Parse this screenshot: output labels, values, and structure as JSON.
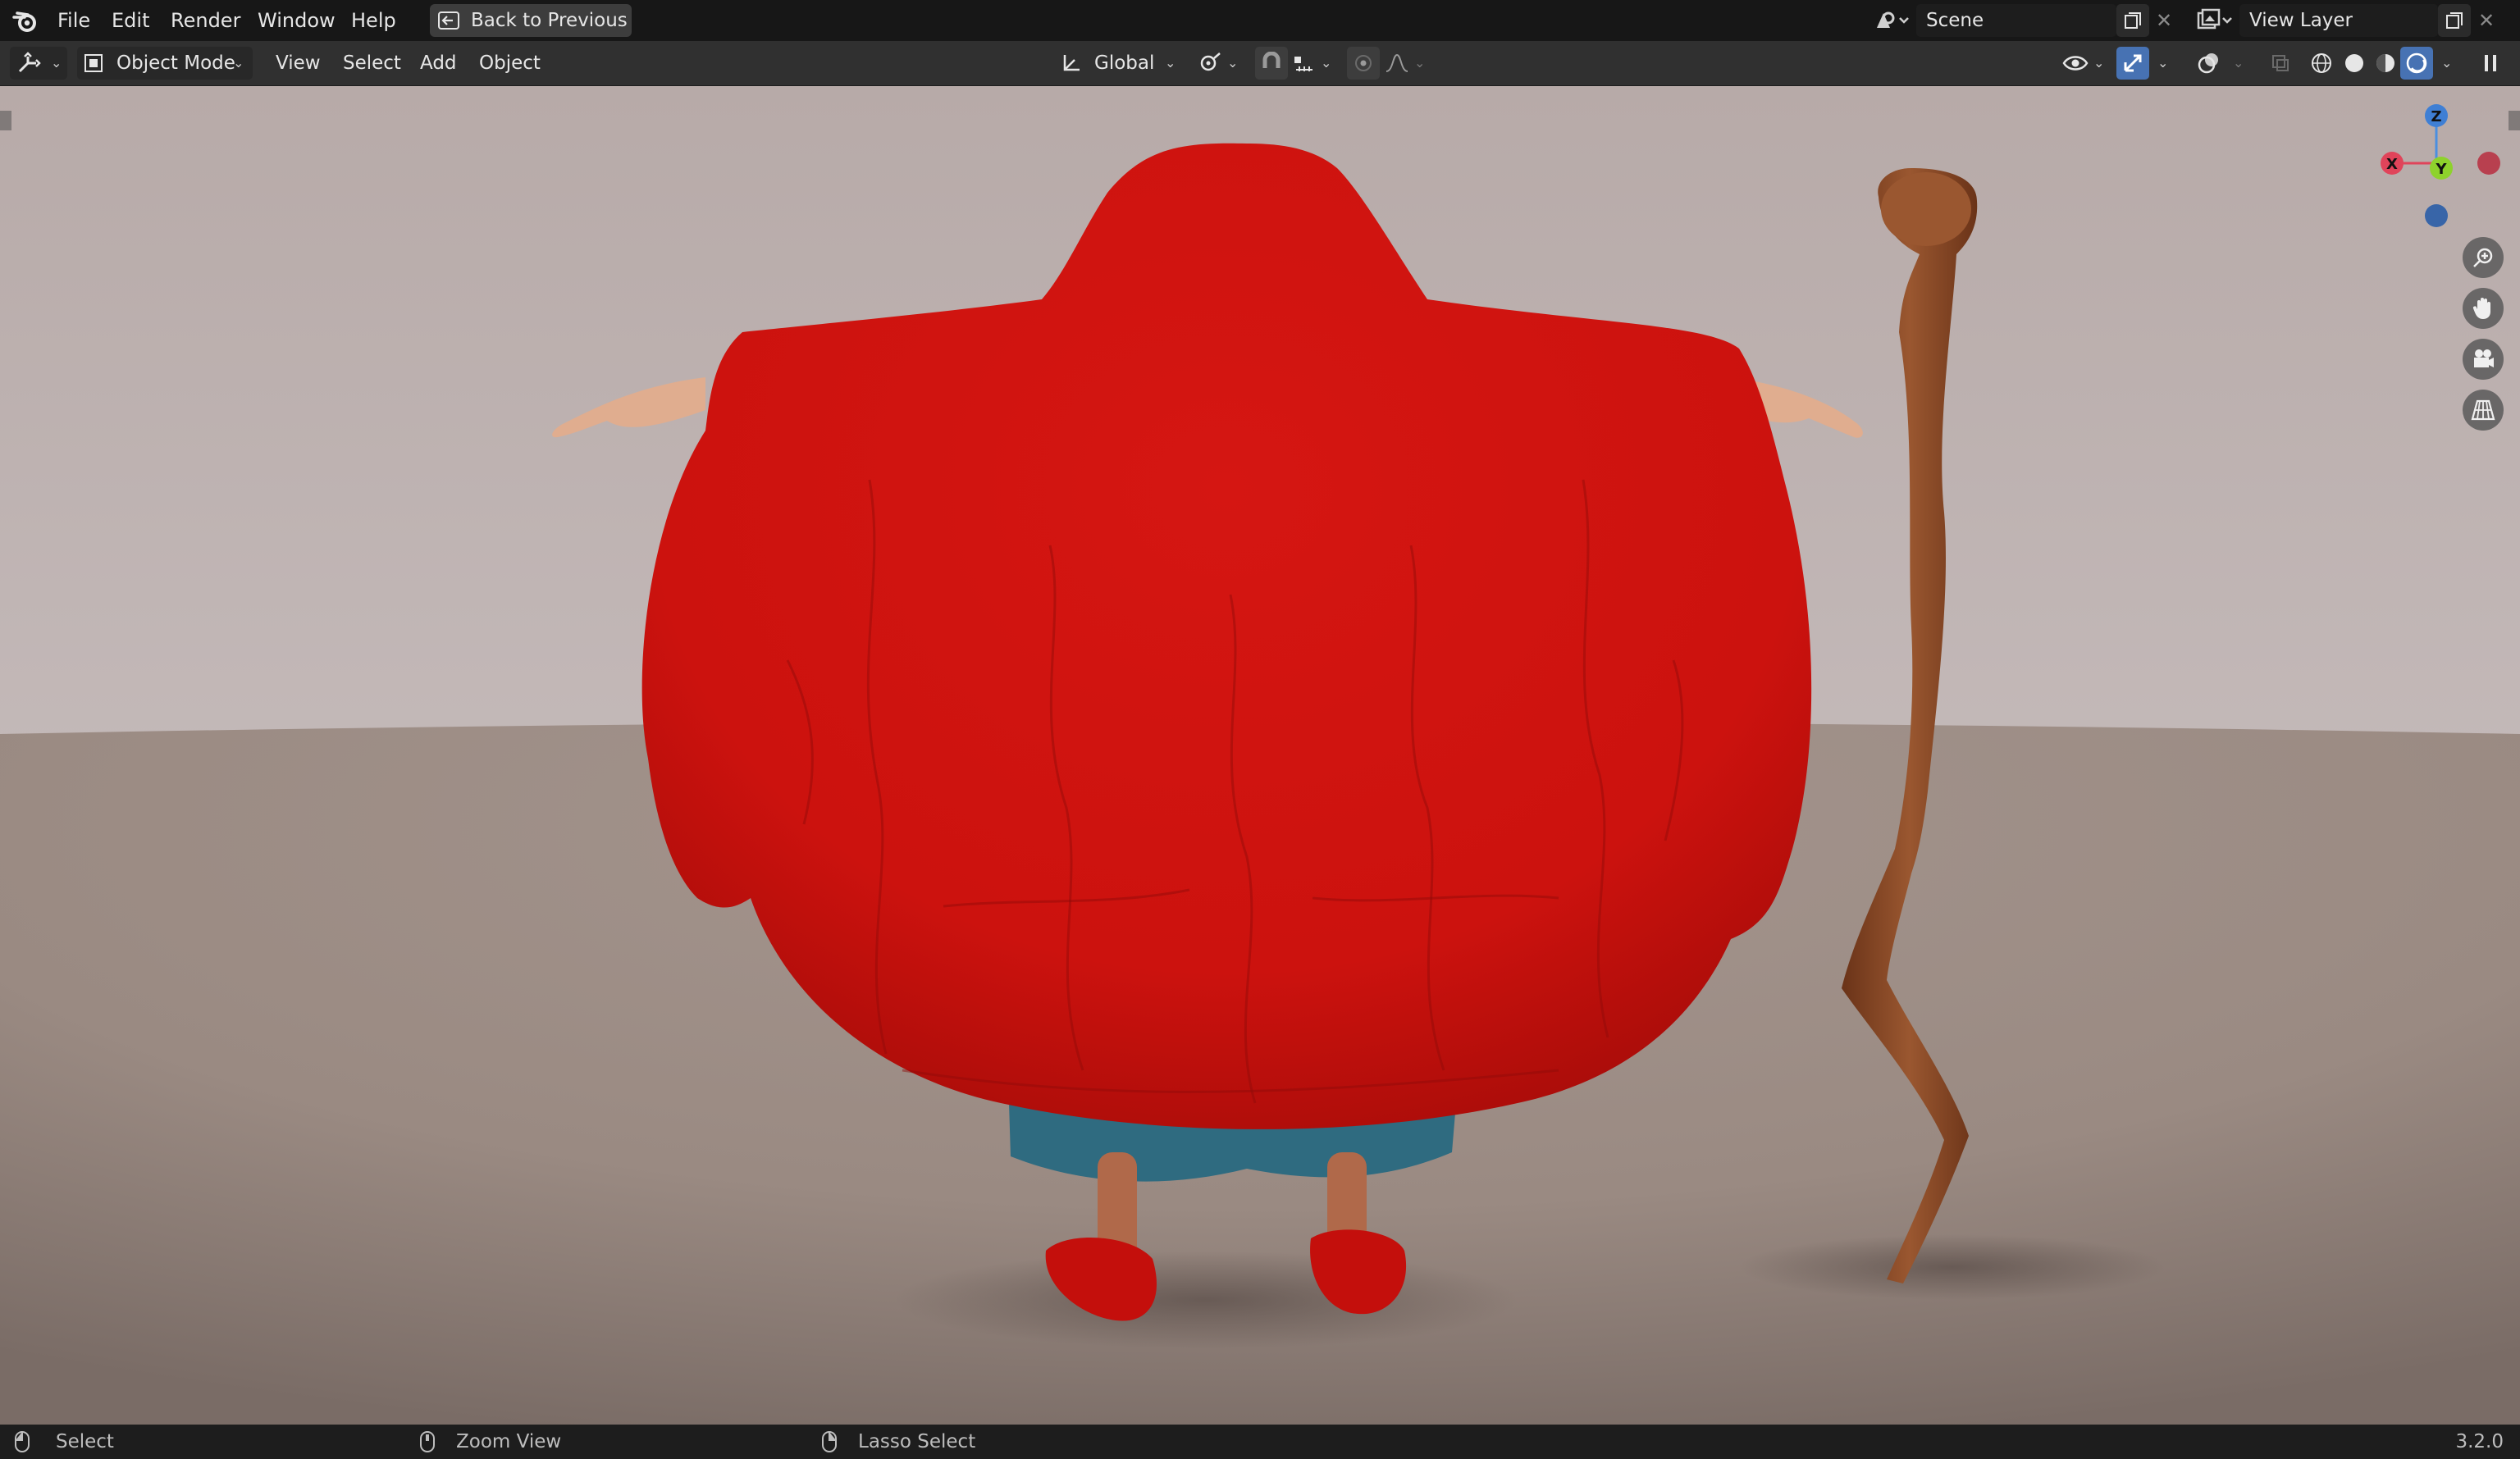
{
  "menu": {
    "items": [
      "File",
      "Edit",
      "Render",
      "Window",
      "Help"
    ],
    "back_button": "Back to Previous"
  },
  "scene": {
    "label": "Scene"
  },
  "view_layer": {
    "label": "View Layer"
  },
  "header": {
    "mode": "Object Mode",
    "menus": [
      "View",
      "Select",
      "Add",
      "Object"
    ],
    "transform_orientation": "Global"
  },
  "gizmo": {
    "z": "Z",
    "y": "Y",
    "x": "X"
  },
  "statusbar": {
    "select": "Select",
    "zoom": "Zoom View",
    "lasso": "Lasso Select",
    "version": "3.2.0"
  },
  "colors": {
    "cloak": "#d4110f",
    "staff": "#8a4a28",
    "skirt": "#2f6b80",
    "active_icon": "#4772b3"
  },
  "icons": [
    "blender-logo-icon",
    "back-arrow-icon",
    "editor-type-icon",
    "object-mode-icon",
    "orientation-icon",
    "pivot-icon",
    "snap-icon",
    "proportional-icon",
    "visibility-icon",
    "gizmo-icon",
    "overlay-icon",
    "xray-icon",
    "wireframe-shading-icon",
    "solid-shading-icon",
    "material-shading-icon",
    "rendered-shading-icon",
    "zoom-icon",
    "hand-pan-icon",
    "camera-icon",
    "perspective-grid-icon",
    "mouse-icon"
  ]
}
